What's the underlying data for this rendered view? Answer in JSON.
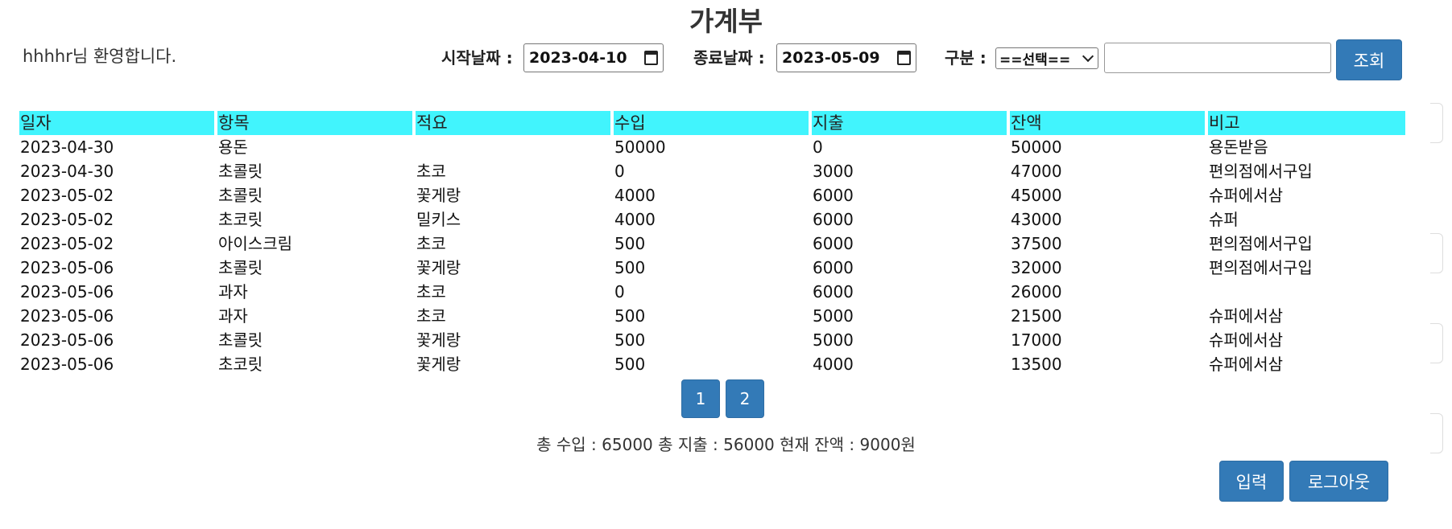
{
  "page": {
    "title": "가계부",
    "welcome": "hhhhr님 환영합니다."
  },
  "search": {
    "start_label": "시작날짜 :",
    "start_value": "2023-04-10",
    "end_label": "종료날짜 :",
    "end_value": "2023-05-09",
    "category_label": "구분 :",
    "category_selected": "==선택==",
    "keyword_value": "",
    "search_button": "조회"
  },
  "table": {
    "headers": [
      "일자",
      "항목",
      "적요",
      "수입",
      "지출",
      "잔액",
      "비고"
    ],
    "rows": [
      [
        "2023-04-30",
        "용돈",
        "",
        "50000",
        "0",
        "50000",
        "용돈받음"
      ],
      [
        "2023-04-30",
        "초콜릿",
        "초코",
        "0",
        "3000",
        "47000",
        "편의점에서구입"
      ],
      [
        "2023-05-02",
        "초콜릿",
        "꽃게랑",
        "4000",
        "6000",
        "45000",
        "슈퍼에서삼"
      ],
      [
        "2023-05-02",
        "초코릿",
        "밀키스",
        "4000",
        "6000",
        "43000",
        "슈퍼"
      ],
      [
        "2023-05-02",
        "아이스크림",
        "초코",
        "500",
        "6000",
        "37500",
        "편의점에서구입"
      ],
      [
        "2023-05-06",
        "초콜릿",
        "꽃게랑",
        "500",
        "6000",
        "32000",
        "편의점에서구입"
      ],
      [
        "2023-05-06",
        "과자",
        "초코",
        "0",
        "6000",
        "26000",
        ""
      ],
      [
        "2023-05-06",
        "과자",
        "초코",
        "500",
        "5000",
        "21500",
        "슈퍼에서삼"
      ],
      [
        "2023-05-06",
        "초콜릿",
        "꽃게랑",
        "500",
        "5000",
        "17000",
        "슈퍼에서삼"
      ],
      [
        "2023-05-06",
        "초코릿",
        "꽃게랑",
        "500",
        "4000",
        "13500",
        "슈퍼에서삼"
      ]
    ]
  },
  "pagination": {
    "pages": [
      "1",
      "2"
    ]
  },
  "summary": {
    "text": "총 수입 : 65000 총 지출 : 56000 현재 잔액 : 9000원"
  },
  "actions": {
    "input_button": "입력",
    "logout_button": "로그아웃"
  },
  "colors": {
    "header_bg": "#41f4fd",
    "button_bg": "#337ab7"
  }
}
